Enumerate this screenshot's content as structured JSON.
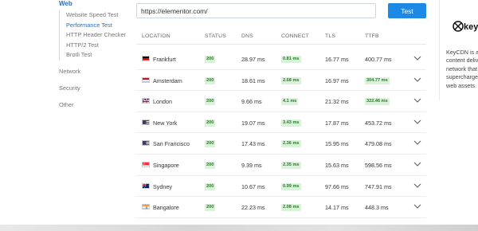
{
  "sidebar": {
    "web_label": "Web",
    "sub_items": [
      {
        "label": "Website Speed Test",
        "active": false
      },
      {
        "label": "Performance Test",
        "active": true
      },
      {
        "label": "HTTP Header Checker",
        "active": false
      },
      {
        "label": "HTTP/2 Test",
        "active": false
      },
      {
        "label": "Brotli Test",
        "active": false
      }
    ],
    "network_label": "Network",
    "security_label": "Security",
    "other_label": "Other"
  },
  "search": {
    "url_value": "https://elementor.com/",
    "test_label": "Test"
  },
  "table": {
    "headers": [
      "LOCATION",
      "STATUS",
      "DNS",
      "CONNECT",
      "TLS",
      "TTFB"
    ],
    "rows": [
      {
        "flag": "germany-flag-icon",
        "location": "Frankfurt",
        "status": "200",
        "dns": "28.97 ms",
        "connect": "0.81 ms",
        "tls": "16.77 ms",
        "ttfb": "400.77 ms",
        "ttfb_badge": false
      },
      {
        "flag": "netherlands-flag-icon",
        "location": "Amsterdam",
        "status": "200",
        "dns": "18.61 ms",
        "connect": "2.68 ms",
        "tls": "16.97 ms",
        "ttfb": "304.77 ms",
        "ttfb_badge": true
      },
      {
        "flag": "uk-flag-icon",
        "location": "London",
        "status": "200",
        "dns": "9.66 ms",
        "connect": "4.1 ms",
        "tls": "21.32 ms",
        "ttfb": "322.46 ms",
        "ttfb_badge": true
      },
      {
        "flag": "usa-flag-icon",
        "location": "New York",
        "status": "200",
        "dns": "19.07 ms",
        "connect": "3.43 ms",
        "tls": "17.87 ms",
        "ttfb": "453.72 ms",
        "ttfb_badge": false
      },
      {
        "flag": "usa-flag-icon",
        "location": "San Francisco",
        "status": "200",
        "dns": "17.43 ms",
        "connect": "2.36 ms",
        "tls": "15.95 ms",
        "ttfb": "479.08 ms",
        "ttfb_badge": false
      },
      {
        "flag": "singapore-flag-icon",
        "location": "Singapore",
        "status": "200",
        "dns": "9.39 ms",
        "connect": "2.35 ms",
        "tls": "15.63 ms",
        "ttfb": "598.56 ms",
        "ttfb_badge": false
      },
      {
        "flag": "australia-flag-icon",
        "location": "Sydney",
        "status": "200",
        "dns": "10.67 ms",
        "connect": "0.99 ms",
        "tls": "97.66 ms",
        "ttfb": "747.91 ms",
        "ttfb_badge": false
      },
      {
        "flag": "india-flag-icon",
        "location": "Bangalore",
        "status": "200",
        "dns": "22.23 ms",
        "connect": "2.08 ms",
        "tls": "14.17 ms",
        "ttfb": "448.3 ms",
        "ttfb_badge": false
      }
    ]
  },
  "right_panel": {
    "logo_text": "keyc",
    "lines": [
      "KeyCDN is a",
      "content deliv",
      "network that",
      "supercharge",
      "web assets."
    ]
  },
  "colors": {
    "accent": "#1e88e5",
    "link": "#2a6ebb",
    "badge_bg": "#d9f2d9",
    "badge_text": "#2a7a2a"
  }
}
